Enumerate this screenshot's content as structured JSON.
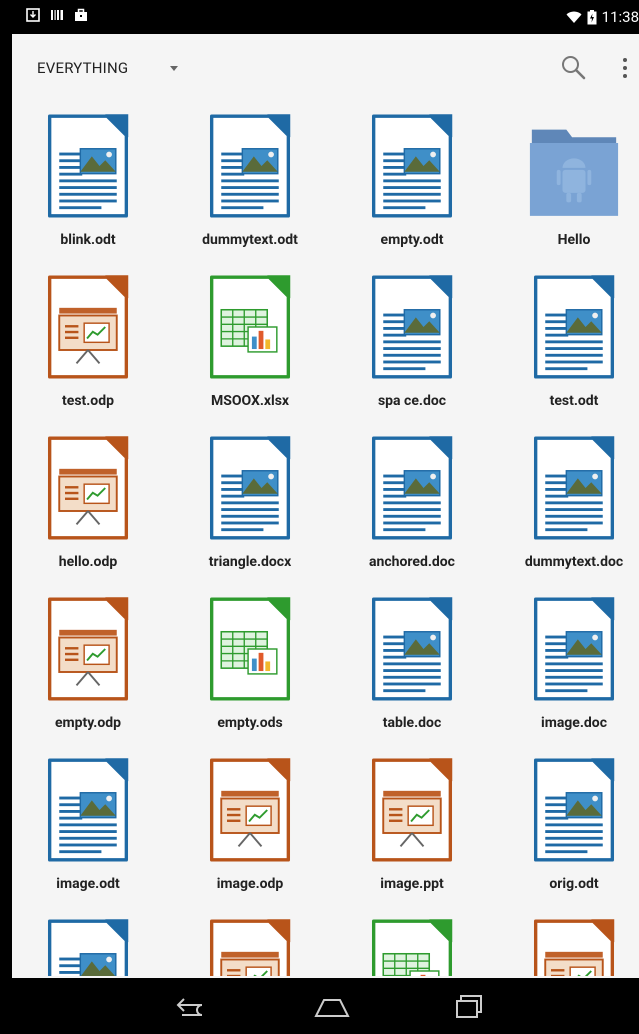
{
  "status_bar": {
    "time": "11:38"
  },
  "toolbar": {
    "filter_label": "EVERYTHING"
  },
  "colors": {
    "writer": "#1f6aa5",
    "impress": "#b8541a",
    "calc": "#2e9b2e",
    "folder": "#7aa3d4"
  },
  "files": [
    {
      "name": "blink.odt",
      "type": "writer"
    },
    {
      "name": "dummytext.odt",
      "type": "writer"
    },
    {
      "name": "empty.odt",
      "type": "writer"
    },
    {
      "name": "Hello",
      "type": "folder"
    },
    {
      "name": "test.odp",
      "type": "impress"
    },
    {
      "name": "MSOOX.xlsx",
      "type": "calc"
    },
    {
      "name": "spa ce.doc",
      "type": "writer"
    },
    {
      "name": "test.odt",
      "type": "writer"
    },
    {
      "name": "hello.odp",
      "type": "impress"
    },
    {
      "name": "triangle.docx",
      "type": "writer"
    },
    {
      "name": "anchored.doc",
      "type": "writer"
    },
    {
      "name": "dummytext.doc",
      "type": "writer"
    },
    {
      "name": "empty.odp",
      "type": "impress"
    },
    {
      "name": "empty.ods",
      "type": "calc"
    },
    {
      "name": "table.doc",
      "type": "writer"
    },
    {
      "name": "image.doc",
      "type": "writer"
    },
    {
      "name": "image.odt",
      "type": "writer"
    },
    {
      "name": "image.odp",
      "type": "impress"
    },
    {
      "name": "image.ppt",
      "type": "impress"
    },
    {
      "name": "orig.odt",
      "type": "writer"
    },
    {
      "name": "",
      "type": "writer"
    },
    {
      "name": "",
      "type": "impress"
    },
    {
      "name": "",
      "type": "calc"
    },
    {
      "name": "",
      "type": "impress"
    }
  ]
}
